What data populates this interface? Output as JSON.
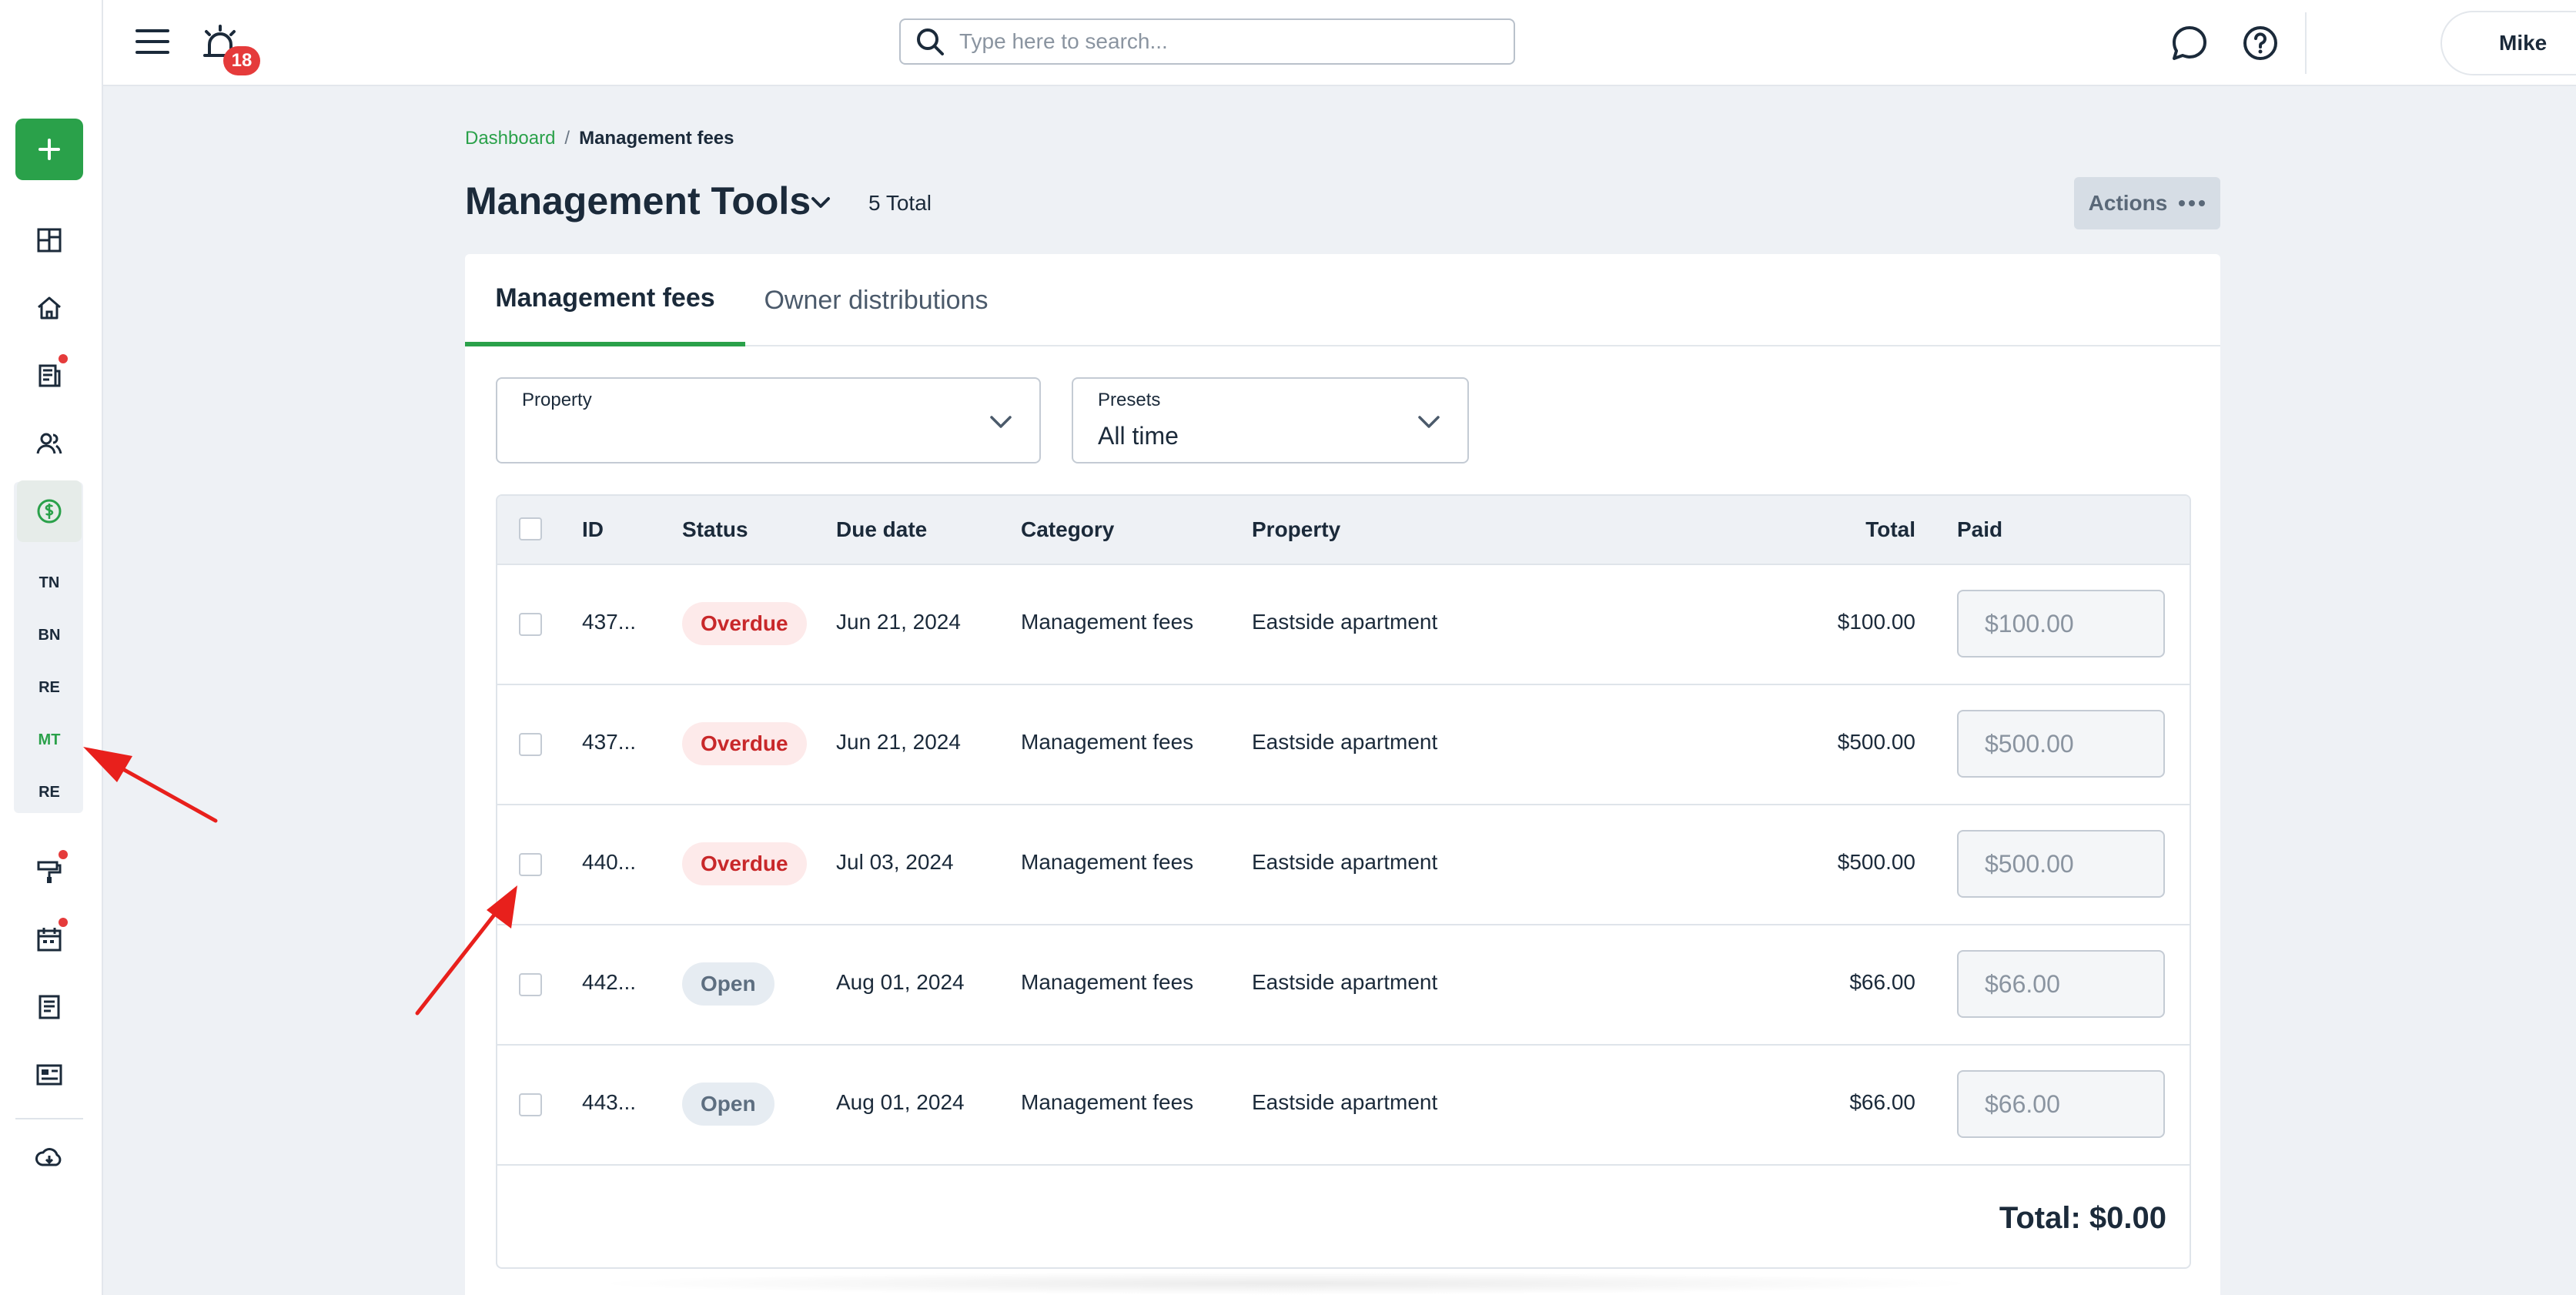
{
  "topbar": {
    "notification_count": "18",
    "search_placeholder": "Type here to search...",
    "user_name": "Mike"
  },
  "sidebar": {
    "sub_items": [
      {
        "label": "TN"
      },
      {
        "label": "BN"
      },
      {
        "label": "RE"
      },
      {
        "label": "MT",
        "active": true
      },
      {
        "label": "RE"
      }
    ]
  },
  "breadcrumb": {
    "home": "Dashboard",
    "separator": "/",
    "current": "Management fees"
  },
  "page": {
    "title": "Management Tools",
    "total": "5 Total",
    "actions_label": "Actions"
  },
  "tabs": [
    {
      "label": "Management fees",
      "active": true
    },
    {
      "label": "Owner distributions",
      "active": false
    }
  ],
  "filters": {
    "property": {
      "label": "Property",
      "value": ""
    },
    "presets": {
      "label": "Presets",
      "value": "All time"
    }
  },
  "table": {
    "headers": {
      "id": "ID",
      "status": "Status",
      "due_date": "Due date",
      "category": "Category",
      "property": "Property",
      "total": "Total",
      "paid": "Paid"
    },
    "rows": [
      {
        "id": "437...",
        "status": "Overdue",
        "due_date": "Jun 21, 2024",
        "category": "Management fees",
        "property": "Eastside apartment",
        "total": "$100.00",
        "paid": "$100.00"
      },
      {
        "id": "437...",
        "status": "Overdue",
        "due_date": "Jun 21, 2024",
        "category": "Management fees",
        "property": "Eastside apartment",
        "total": "$500.00",
        "paid": "$500.00"
      },
      {
        "id": "440...",
        "status": "Overdue",
        "due_date": "Jul 03, 2024",
        "category": "Management fees",
        "property": "Eastside apartment",
        "total": "$500.00",
        "paid": "$500.00"
      },
      {
        "id": "442...",
        "status": "Open",
        "due_date": "Aug 01, 2024",
        "category": "Management fees",
        "property": "Eastside apartment",
        "total": "$66.00",
        "paid": "$66.00"
      },
      {
        "id": "443...",
        "status": "Open",
        "due_date": "Aug 01, 2024",
        "category": "Management fees",
        "property": "Eastside apartment",
        "total": "$66.00",
        "paid": "$66.00"
      }
    ],
    "total_label": "Total: $0.00"
  },
  "colors": {
    "accent": "#2aa14a",
    "overdue": "#c8282a",
    "open": "#5d6e80",
    "annotation": "#e8201c"
  },
  "icons": [
    "add-icon",
    "dashboard-icon",
    "home-icon",
    "document-icon",
    "people-icon",
    "dollar-icon",
    "paint-roller-icon",
    "calendar-icon",
    "list-icon",
    "card-icon",
    "cloud-download-icon",
    "menu-icon",
    "alarm-icon",
    "search-icon",
    "chat-icon",
    "help-icon",
    "chevron-down-icon",
    "more-icon"
  ]
}
